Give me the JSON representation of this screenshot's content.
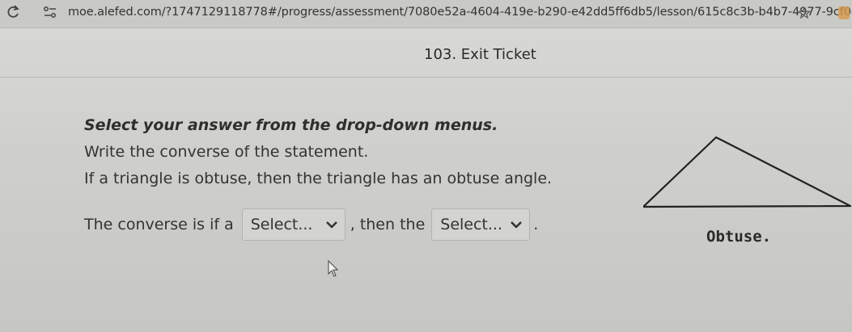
{
  "browser": {
    "url": "moe.alefed.com/?1747129118778#/progress/assessment/7080e52a-4604-419e-b290-e42dd5ff6db5/lesson/615c8c3b-b4b7-4977-9cf0-0000",
    "icons": [
      "reload-icon",
      "site-info-icon",
      "star-icon",
      "extension-icon"
    ]
  },
  "header": {
    "title": "103. Exit Ticket"
  },
  "question": {
    "instruction": "Select your answer from the drop-down menus.",
    "prompt": "Write the converse of the statement.",
    "statement": "If a triangle is obtuse, then the triangle has an obtuse angle.",
    "answer_prefix": "The converse is if a",
    "answer_middle": ", then the",
    "answer_suffix": ".",
    "dropdown1": {
      "selected": "Select..."
    },
    "dropdown2": {
      "selected": "Select..."
    }
  },
  "figure": {
    "caption": "Obtuse."
  }
}
